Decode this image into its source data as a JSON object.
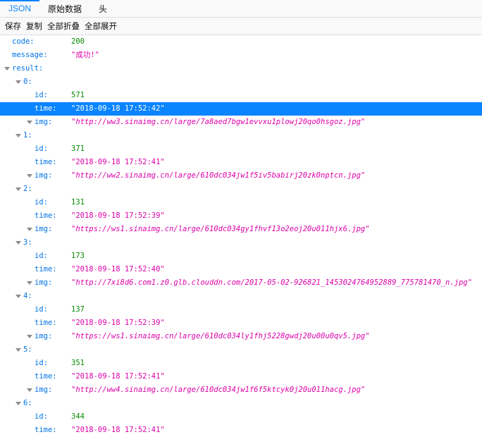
{
  "tabs": [
    {
      "label": "JSON",
      "selected": true
    },
    {
      "label": "原始数据",
      "selected": false
    },
    {
      "label": "头",
      "selected": false
    }
  ],
  "toolbar": {
    "save": "保存",
    "copy": "复制",
    "collapse_all": "全部折叠",
    "expand_all": "全部展开"
  },
  "root": {
    "code_key": "code:",
    "code_value": "200",
    "message_key": "message:",
    "message_value": "\"成功!\"",
    "result_key": "result:"
  },
  "items": [
    {
      "index": "0:",
      "id": "571",
      "time": "\"2018-09-18 17:52:42\"",
      "img": "\"http://ww3.sinaimg.cn/large/7a8aed7bgw1evvxu1plowj20qo0hsgoz.jpg\""
    },
    {
      "index": "1:",
      "id": "371",
      "time": "\"2018-09-18 17:52:41\"",
      "img": "\"http://ww2.sinaimg.cn/large/610dc034jw1f5iv5babirj20zk0nptcn.jpg\""
    },
    {
      "index": "2:",
      "id": "131",
      "time": "\"2018-09-18 17:52:39\"",
      "img": "\"https://ws1.sinaimg.cn/large/610dc034gy1fhvf13o2eoj20u011hjx6.jpg\""
    },
    {
      "index": "3:",
      "id": "173",
      "time": "\"2018-09-18 17:52:40\"",
      "img": "\"http://7xi8d6.com1.z0.glb.clouddn.com/2017-05-02-926821_1453024764952889_775781470_n.jpg\""
    },
    {
      "index": "4:",
      "id": "137",
      "time": "\"2018-09-18 17:52:39\"",
      "img": "\"https://ws1.sinaimg.cn/large/610dc034ly1fhj5228gwdj20u00u0qv5.jpg\""
    },
    {
      "index": "5:",
      "id": "351",
      "time": "\"2018-09-18 17:52:41\"",
      "img": "\"http://ww4.sinaimg.cn/large/610dc034jw1f6f5ktcyk0j20u011hacg.jpg\""
    },
    {
      "index": "6:",
      "id": "344",
      "time": "\"2018-09-18 17:52:41\"",
      "img": ""
    }
  ],
  "field_keys": {
    "id": "id:",
    "time": "time:",
    "img": "img:"
  },
  "selected_row": "0.time",
  "colors": {
    "accent": "#0a84ff",
    "key": "#0074e8",
    "number": "#058b00",
    "string": "#dd00a9"
  }
}
